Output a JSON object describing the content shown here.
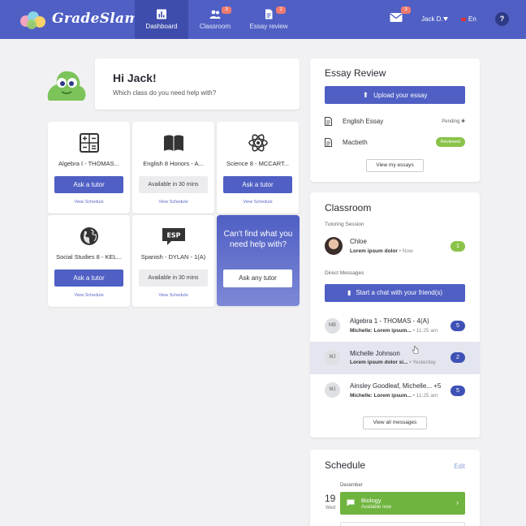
{
  "app": {
    "name": "GradeSlam"
  },
  "nav": {
    "tabs": [
      {
        "label": "Dashboard",
        "icon": "chart-icon"
      },
      {
        "label": "Classroom",
        "icon": "people-icon",
        "badge": "3"
      },
      {
        "label": "Essay review",
        "icon": "document-icon",
        "badge": "2"
      }
    ],
    "mail_badge": "3",
    "user_name": "Jack D.",
    "language": "En",
    "help_label": "?"
  },
  "greeting": {
    "title": "Hi Jack!",
    "subtitle": "Which class do you need help with?"
  },
  "classes": [
    {
      "name": "Algebra I - THOMAS...",
      "icon": "calculator-icon",
      "action": "Ask a tutor",
      "available": false,
      "schedule_link": "View Schedule"
    },
    {
      "name": "English 8 Honors - A...",
      "icon": "book-icon",
      "action": "Available in 30 mins",
      "available": true,
      "schedule_link": "View Schedule"
    },
    {
      "name": "Science 8 - MCCART...",
      "icon": "atom-icon",
      "action": "Ask a tutor",
      "available": false,
      "schedule_link": "View Schedule"
    },
    {
      "name": "Social Studies 8 - KEL...",
      "icon": "globe-icon",
      "action": "Ask a tutor",
      "available": false,
      "schedule_link": "View Schedule"
    },
    {
      "name": "Spanish - DYLAN - 1(A)",
      "icon": "esp-icon",
      "icon_text": "ESP",
      "action": "Available in 30 mins",
      "available": true,
      "schedule_link": "View Schedule"
    }
  ],
  "cant_find": {
    "text": "Can't find what you need help with?",
    "button": "Ask any tutor"
  },
  "essay_review": {
    "title": "Essay Review",
    "upload_label": "Upload your essay",
    "essays": [
      {
        "name": "English Essay",
        "status": "Pending"
      },
      {
        "name": "Macbeth",
        "status": "Reviewed"
      }
    ],
    "view_label": "View my essays"
  },
  "classroom": {
    "title": "Classroom",
    "tutoring_label": "Tutoring Session",
    "tutor": {
      "name": "Chloe",
      "message": "Lorem ipsum dolor",
      "time": "Now",
      "count": "1"
    },
    "dm_label": "Direct Messages",
    "chat_button": "Start a chat with your friend(s)",
    "messages": [
      {
        "initials": "MB",
        "title": "Algebra 1 - THOMAS - 4(A)",
        "sender": "Michelle:",
        "preview": "Lorem ipsum...",
        "time": "11:25 am",
        "count": "5"
      },
      {
        "initials": "MJ",
        "title": "Michelle Johnson",
        "sender": "",
        "preview": "Lorem ipsum dolor si...",
        "time": "Yesterday",
        "count": "2"
      },
      {
        "initials": "MJ",
        "title": "Ainsley Goodleaf, Michelle... +5",
        "sender": "Michelle:",
        "preview": "Lorem ipsum...",
        "time": "11:25 am",
        "count": "5"
      }
    ],
    "view_all": "View all messages"
  },
  "schedule": {
    "title": "Schedule",
    "edit_label": "Edit",
    "month": "December",
    "day": "19",
    "weekday": "Wed",
    "event": {
      "title": "Biology",
      "status": "Available now"
    }
  },
  "colors": {
    "primary": "#4f5fc4",
    "green": "#8bc34a",
    "badge": "#ef7a6f"
  }
}
